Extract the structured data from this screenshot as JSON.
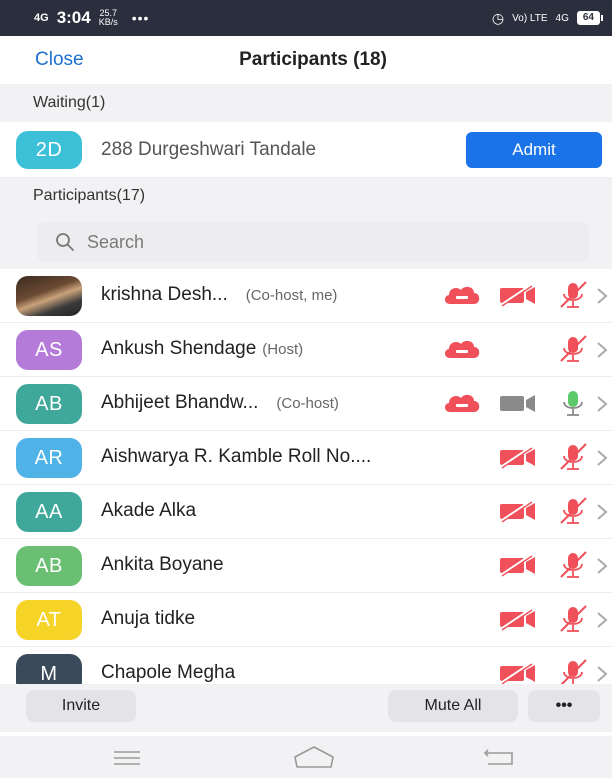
{
  "status_bar": {
    "network": "4G",
    "time": "3:04",
    "speed_value": "25.7",
    "speed_unit": "KB/s",
    "dots": "•••",
    "volte": "Vo) LTE",
    "network_right": "4G",
    "battery": "64"
  },
  "header": {
    "close_label": "Close",
    "title": "Participants (18)"
  },
  "waiting": {
    "section_label": "Waiting(1)",
    "user": {
      "initials": "2D",
      "name": "288 Durgeshwari Tandale",
      "avatar_color": "#3cc0d8"
    },
    "admit_label": "Admit"
  },
  "participants_section_label": "Participants(17)",
  "search": {
    "placeholder": "Search"
  },
  "participants": [
    {
      "initials": "",
      "photo": true,
      "name": "krishna Desh...",
      "role": "(Co-host, me)",
      "cloud": true,
      "video": "off",
      "mic": "off",
      "avatar_color": "#5a3d2b"
    },
    {
      "initials": "AS",
      "name": "Ankush Shendage",
      "role": "(Host)",
      "cloud": true,
      "video": "none",
      "mic": "off",
      "avatar_color": "#b57bd8"
    },
    {
      "initials": "AB",
      "name": "Abhijeet Bhandw...",
      "role": "(Co-host)",
      "cloud": true,
      "video": "on",
      "mic": "on",
      "avatar_color": "#3fa89a"
    },
    {
      "initials": "AR",
      "name": "Aishwarya R. Kamble Roll No....",
      "role": "",
      "cloud": false,
      "video": "off",
      "mic": "off",
      "avatar_color": "#4fb3e8"
    },
    {
      "initials": "AA",
      "name": "Akade Alka",
      "role": "",
      "cloud": false,
      "video": "off",
      "mic": "off",
      "avatar_color": "#3fa89a"
    },
    {
      "initials": "AB",
      "name": "Ankita Boyane",
      "role": "",
      "cloud": false,
      "video": "off",
      "mic": "off",
      "avatar_color": "#6bbf73"
    },
    {
      "initials": "AT",
      "name": "Anuja tidke",
      "role": "",
      "cloud": false,
      "video": "off",
      "mic": "off",
      "avatar_color": "#f5d327"
    },
    {
      "initials": "M",
      "name": "Chapole Megha",
      "role": "",
      "cloud": false,
      "video": "off",
      "mic": "off",
      "avatar_color": "#3b4a5a"
    }
  ],
  "toolbar": {
    "invite_label": "Invite",
    "mute_all_label": "Mute All",
    "more_label": "•••"
  },
  "icons": {
    "search": "search-icon",
    "cloud": "cloud-record-icon",
    "video_off": "video-off-icon",
    "video_on": "video-icon",
    "mic_off": "mic-off-icon",
    "mic_on": "mic-icon",
    "chevron": "chevron-right-icon",
    "menu": "menu-icon",
    "home": "home-icon",
    "back": "back-icon"
  },
  "colors": {
    "accent": "#1a73e8",
    "muted_red": "#f0505a",
    "gray_icon": "#8a8a8a",
    "mic_on_green": "#5cc96a"
  }
}
